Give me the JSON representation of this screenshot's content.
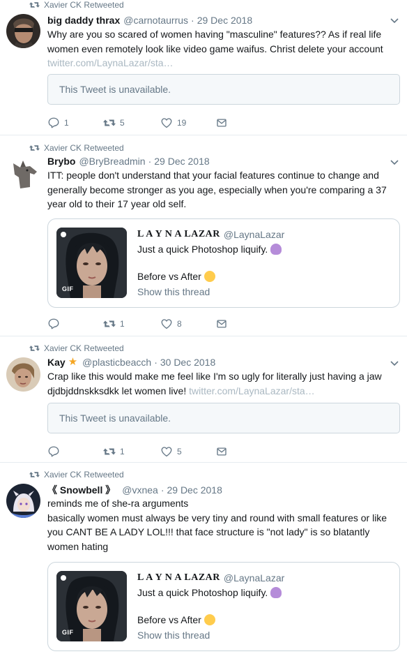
{
  "tweets": [
    {
      "retweeted_by": "Xavier CK Retweeted",
      "name": "big daddy thrax",
      "handle": "@carnotaurrus",
      "dot": "·",
      "date": "29 Dec 2018",
      "text": "Why are you so scared of women having \"masculine\" features?? As if real life women even remotely look like video game waifus. Christ delete your account",
      "link": "twitter.com/LaynaLazar/sta…",
      "unavailable": "This Tweet is unavailable.",
      "reply_count": "1",
      "retweet_count": "5",
      "like_count": "19"
    },
    {
      "retweeted_by": "Xavier CK Retweeted",
      "name": "Brybo",
      "handle": "@BryBreadmin",
      "dot": "·",
      "date": "29 Dec 2018",
      "text": "ITT: people don't understand that your facial features continue to change and generally become stronger as you age, especially when you're comparing a 37 year old to their 17 year old self.",
      "quote": {
        "name": "L A Y N A LAZAR",
        "handle": "@LaynaLazar",
        "line1": "Just a quick Photoshop liquify.",
        "line2": "Before vs After",
        "thread": "Show this thread",
        "media_badge": "GIF"
      },
      "reply_count": "",
      "retweet_count": "1",
      "like_count": "8"
    },
    {
      "retweeted_by": "Xavier CK Retweeted",
      "name": "Kay",
      "handle": "@plasticbeacch",
      "dot": "·",
      "date": "30 Dec 2018",
      "text": "Crap like this would make me feel like I'm so ugly for literally just having a jaw djdbjddnskksdkk let women live!",
      "link": "twitter.com/LaynaLazar/sta…",
      "unavailable": "This Tweet is unavailable.",
      "reply_count": "",
      "retweet_count": "1",
      "like_count": "5"
    },
    {
      "retweeted_by": "Xavier CK Retweeted",
      "name": "《 Snowbell 》",
      "handle": "@vxnea",
      "dot": "·",
      "date": "29 Dec 2018",
      "text1": "reminds me of she-ra arguments",
      "text2": "basically women must always be very tiny and round with small features  or like you CANT BE A LADY LOL!!! that face structure is \"not lady\" is so blatantly women hating",
      "quote": {
        "name": "L A Y N A LAZAR",
        "handle": "@LaynaLazar",
        "line1": "Just a quick Photoshop liquify.",
        "line2": "Before vs After",
        "thread": "Show this thread",
        "media_badge": "GIF"
      }
    }
  ],
  "icons": {
    "retweet_small": "retweet-icon",
    "reply": "reply-icon",
    "retweet": "retweet-icon",
    "like": "heart-icon",
    "dm": "envelope-icon",
    "caret": "chevron-down-icon",
    "star": "star-icon",
    "purple_heart": "purple-heart-emoji",
    "upside_down_face": "upside-down-face-emoji"
  },
  "colors": {
    "text": "#14171a",
    "secondary": "#657786",
    "link_muted": "#aab8c2",
    "border": "#e6ecf0",
    "star": "#f5a623"
  }
}
